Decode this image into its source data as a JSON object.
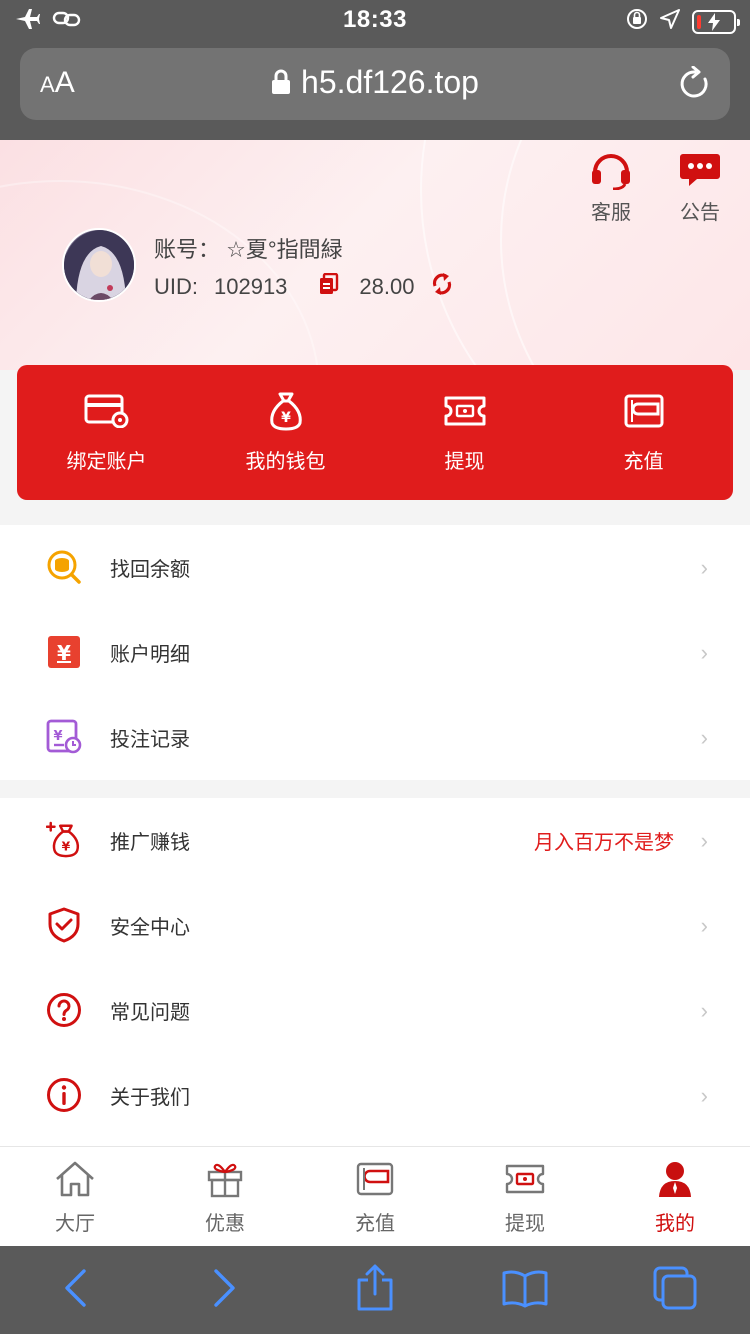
{
  "status_bar": {
    "time": "18:33"
  },
  "browser": {
    "aa_small": "A",
    "aa_large": "A",
    "url": "h5.df126.top"
  },
  "header": {
    "service_label": "客服",
    "notice_label": "公告",
    "account_label": "账号：",
    "account_value": "☆夏°指間緑",
    "uid_label": "UID:",
    "uid_value": "102913",
    "balance": "28.00"
  },
  "quick_actions": [
    {
      "label": "绑定账户",
      "icon": "bind-card-icon"
    },
    {
      "label": "我的钱包",
      "icon": "money-bag-icon"
    },
    {
      "label": "提现",
      "icon": "withdraw-ticket-icon"
    },
    {
      "label": "充值",
      "icon": "wallet-icon"
    }
  ],
  "menu_group1": [
    {
      "label": "找回余额",
      "icon": "coin-search-icon"
    },
    {
      "label": "账户明细",
      "icon": "ledger-icon"
    },
    {
      "label": "投注记录",
      "icon": "bet-record-icon"
    }
  ],
  "menu_group2": [
    {
      "label": "推广赚钱",
      "hint": "月入百万不是梦",
      "icon": "promote-bag-icon"
    },
    {
      "label": "安全中心",
      "hint": "",
      "icon": "shield-check-icon"
    },
    {
      "label": "常见问题",
      "hint": "",
      "icon": "question-icon"
    },
    {
      "label": "关于我们",
      "hint": "",
      "icon": "info-icon"
    }
  ],
  "tabs": [
    {
      "label": "大厅",
      "icon": "home-icon"
    },
    {
      "label": "优惠",
      "icon": "gift-icon"
    },
    {
      "label": "充值",
      "icon": "wallet-icon"
    },
    {
      "label": "提现",
      "icon": "withdraw-ticket-icon"
    },
    {
      "label": "我的",
      "icon": "user-icon",
      "active": true
    }
  ],
  "colors": {
    "brand_red": "#e01c1c",
    "active_tab": "#d01010",
    "browser_gray": "#5a5a5a"
  }
}
